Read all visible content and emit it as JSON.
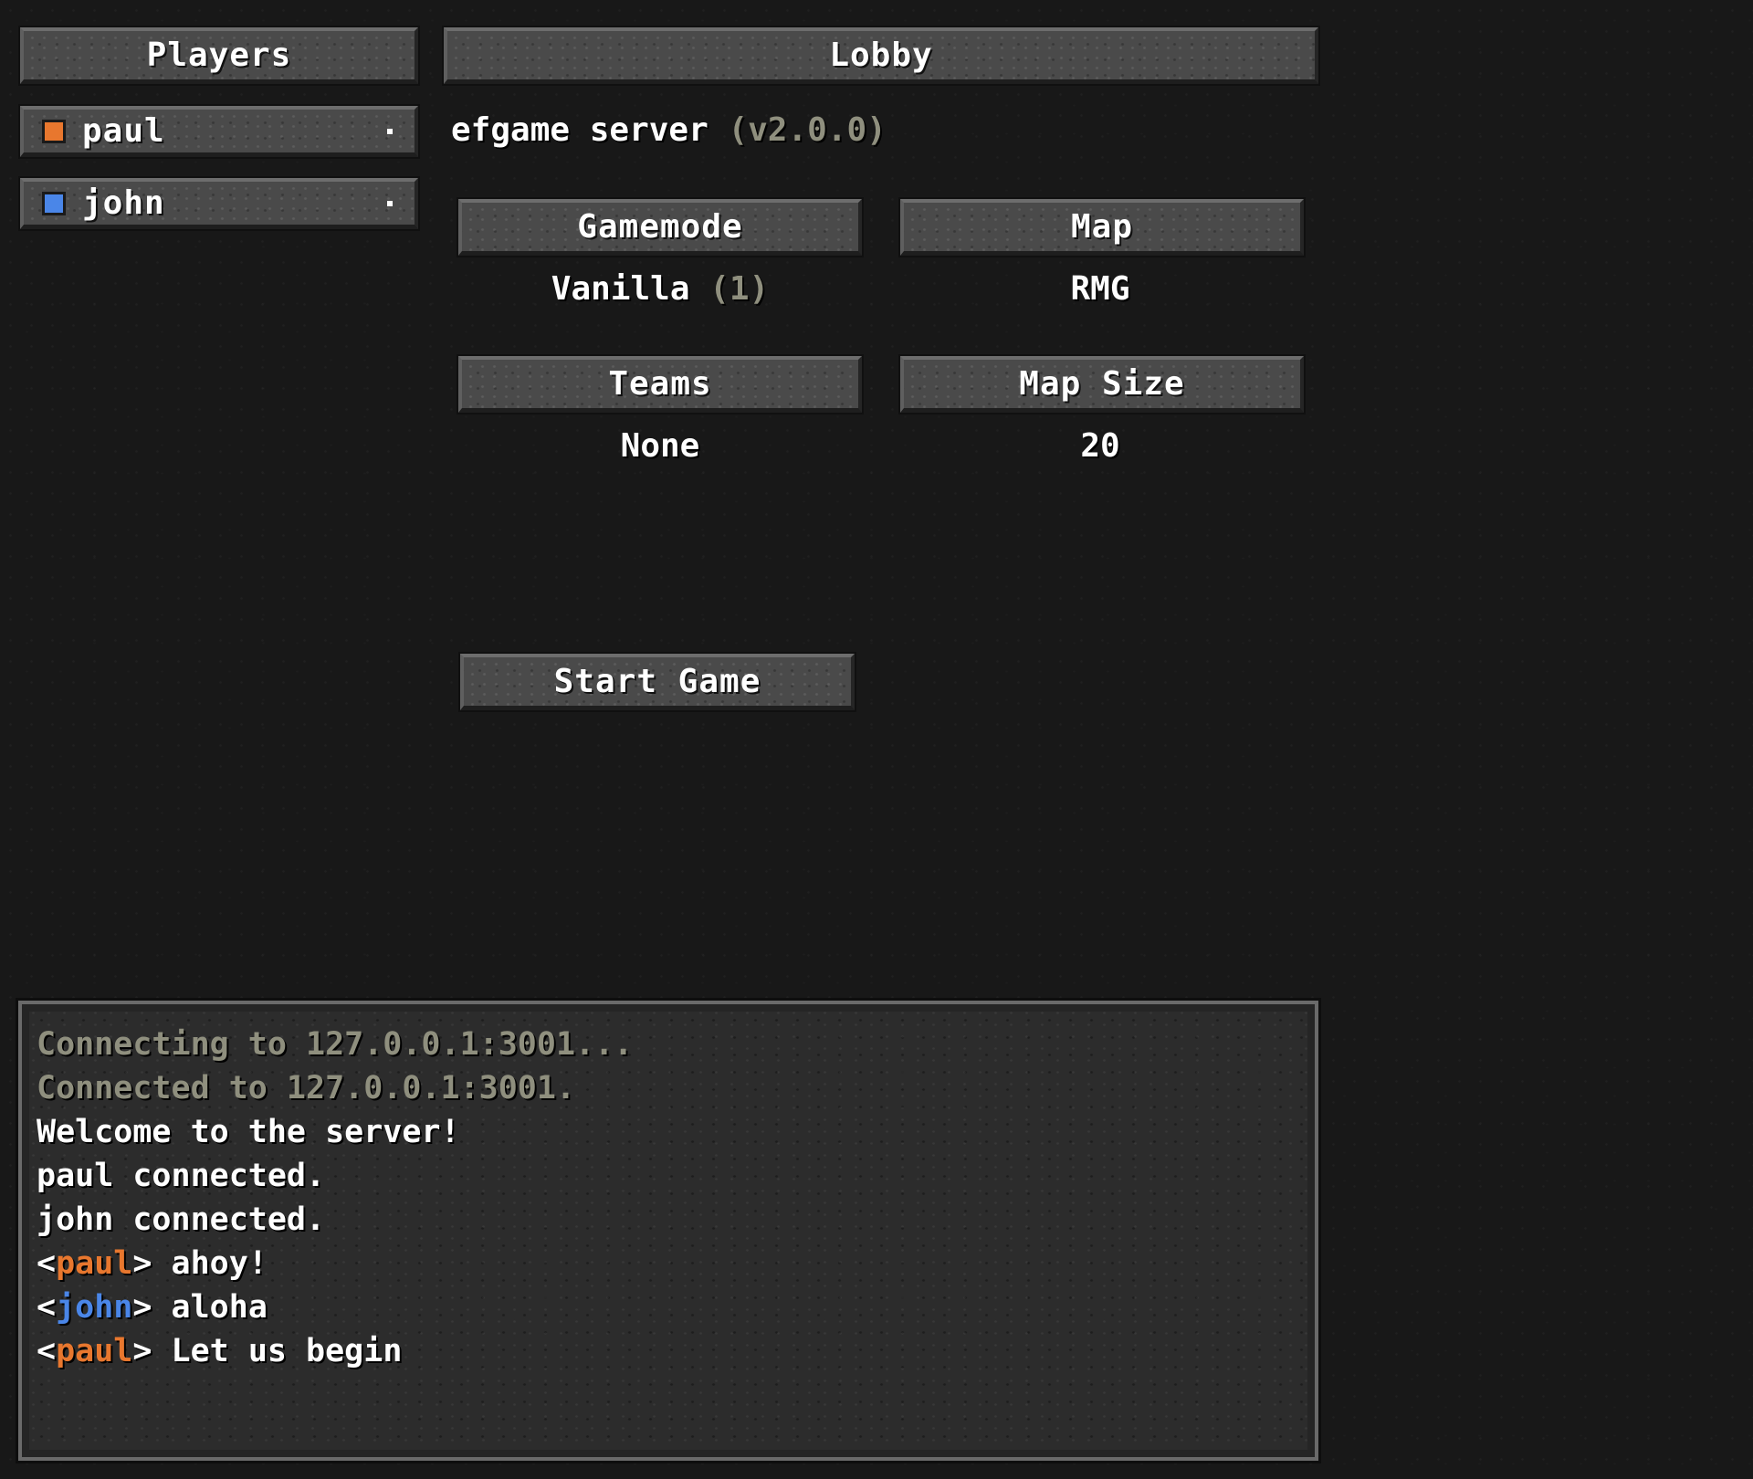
{
  "players_panel": {
    "header": "Players",
    "players": [
      {
        "name": "paul",
        "color": "#e8772e"
      },
      {
        "name": "john",
        "color": "#4a86e8"
      }
    ]
  },
  "lobby": {
    "header": "Lobby",
    "server_name": "efgame server",
    "server_version": "(v2.0.0)",
    "settings": {
      "gamemode": {
        "label": "Gamemode",
        "value": "Vanilla",
        "value_suffix": "(1)"
      },
      "map": {
        "label": "Map",
        "value": "RMG"
      },
      "teams": {
        "label": "Teams",
        "value": "None"
      },
      "map_size": {
        "label": "Map Size",
        "value": "20"
      }
    },
    "start_button": "Start Game"
  },
  "console": {
    "system_lines": [
      "Connecting to 127.0.0.1:3001...",
      "Connected to 127.0.0.1:3001."
    ],
    "info_lines": [
      "Welcome to the server!",
      "paul connected.",
      "john connected."
    ],
    "chat": [
      {
        "nick": "paul",
        "message": "ahoy!"
      },
      {
        "nick": "john",
        "message": "aloha"
      },
      {
        "nick": "paul",
        "message": "Let us begin"
      }
    ]
  },
  "colors": {
    "background": "#181818",
    "button_stone": "#4a4a4a",
    "muted_text": "#8f8f7e",
    "paul": "#e8772e",
    "john": "#4a86e8"
  }
}
